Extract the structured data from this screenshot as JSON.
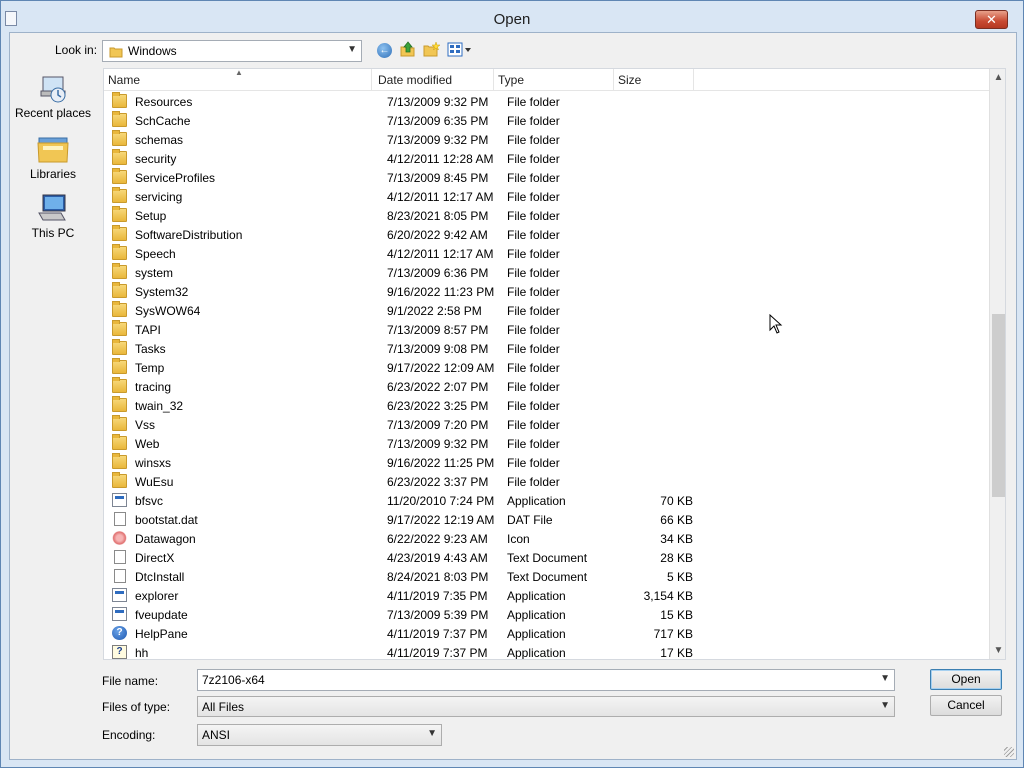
{
  "window": {
    "title": "Open",
    "close_label": "✕"
  },
  "toolbar": {
    "lookin_label": "Look in:",
    "lookin_value": "Windows",
    "icons": [
      "back-icon",
      "up-folder-icon",
      "new-folder-icon",
      "views-menu-icon"
    ]
  },
  "places": [
    {
      "label": "Recent places",
      "icon": "recent-places-icon"
    },
    {
      "label": "Libraries",
      "icon": "libraries-icon"
    },
    {
      "label": "This PC",
      "icon": "this-pc-icon"
    }
  ],
  "columns": {
    "name": "Name",
    "date": "Date modified",
    "type": "Type",
    "size": "Size"
  },
  "files": [
    {
      "name": "Resources",
      "date": "7/13/2009 9:32 PM",
      "type": "File folder",
      "size": "",
      "icon": "folder"
    },
    {
      "name": "SchCache",
      "date": "7/13/2009 6:35 PM",
      "type": "File folder",
      "size": "",
      "icon": "folder"
    },
    {
      "name": "schemas",
      "date": "7/13/2009 9:32 PM",
      "type": "File folder",
      "size": "",
      "icon": "folder"
    },
    {
      "name": "security",
      "date": "4/12/2011 12:28 AM",
      "type": "File folder",
      "size": "",
      "icon": "folder"
    },
    {
      "name": "ServiceProfiles",
      "date": "7/13/2009 8:45 PM",
      "type": "File folder",
      "size": "",
      "icon": "folder"
    },
    {
      "name": "servicing",
      "date": "4/12/2011 12:17 AM",
      "type": "File folder",
      "size": "",
      "icon": "folder"
    },
    {
      "name": "Setup",
      "date": "8/23/2021 8:05 PM",
      "type": "File folder",
      "size": "",
      "icon": "folder"
    },
    {
      "name": "SoftwareDistribution",
      "date": "6/20/2022 9:42 AM",
      "type": "File folder",
      "size": "",
      "icon": "folder"
    },
    {
      "name": "Speech",
      "date": "4/12/2011 12:17 AM",
      "type": "File folder",
      "size": "",
      "icon": "folder"
    },
    {
      "name": "system",
      "date": "7/13/2009 6:36 PM",
      "type": "File folder",
      "size": "",
      "icon": "folder"
    },
    {
      "name": "System32",
      "date": "9/16/2022 11:23 PM",
      "type": "File folder",
      "size": "",
      "icon": "folder"
    },
    {
      "name": "SysWOW64",
      "date": "9/1/2022 2:58 PM",
      "type": "File folder",
      "size": "",
      "icon": "folder"
    },
    {
      "name": "TAPI",
      "date": "7/13/2009 8:57 PM",
      "type": "File folder",
      "size": "",
      "icon": "folder"
    },
    {
      "name": "Tasks",
      "date": "7/13/2009 9:08 PM",
      "type": "File folder",
      "size": "",
      "icon": "folder"
    },
    {
      "name": "Temp",
      "date": "9/17/2022 12:09 AM",
      "type": "File folder",
      "size": "",
      "icon": "folder"
    },
    {
      "name": "tracing",
      "date": "6/23/2022 2:07 PM",
      "type": "File folder",
      "size": "",
      "icon": "folder"
    },
    {
      "name": "twain_32",
      "date": "6/23/2022 3:25 PM",
      "type": "File folder",
      "size": "",
      "icon": "folder"
    },
    {
      "name": "Vss",
      "date": "7/13/2009 7:20 PM",
      "type": "File folder",
      "size": "",
      "icon": "folder"
    },
    {
      "name": "Web",
      "date": "7/13/2009 9:32 PM",
      "type": "File folder",
      "size": "",
      "icon": "folder"
    },
    {
      "name": "winsxs",
      "date": "9/16/2022 11:25 PM",
      "type": "File folder",
      "size": "",
      "icon": "folder"
    },
    {
      "name": "WuEsu",
      "date": "6/23/2022 3:37 PM",
      "type": "File folder",
      "size": "",
      "icon": "folder"
    },
    {
      "name": "bfsvc",
      "date": "11/20/2010 7:24 PM",
      "type": "Application",
      "size": "70 KB",
      "icon": "app"
    },
    {
      "name": "bootstat.dat",
      "date": "9/17/2022 12:19 AM",
      "type": "DAT File",
      "size": "66 KB",
      "icon": "file"
    },
    {
      "name": "Datawagon",
      "date": "6/22/2022 9:23 AM",
      "type": "Icon",
      "size": "34 KB",
      "icon": "icon"
    },
    {
      "name": "DirectX",
      "date": "4/23/2019 4:43 AM",
      "type": "Text Document",
      "size": "28 KB",
      "icon": "file"
    },
    {
      "name": "DtcInstall",
      "date": "8/24/2021 8:03 PM",
      "type": "Text Document",
      "size": "5 KB",
      "icon": "file"
    },
    {
      "name": "explorer",
      "date": "4/11/2019 7:35 PM",
      "type": "Application",
      "size": "3,154 KB",
      "icon": "app"
    },
    {
      "name": "fveupdate",
      "date": "7/13/2009 5:39 PM",
      "type": "Application",
      "size": "15 KB",
      "icon": "app"
    },
    {
      "name": "HelpPane",
      "date": "4/11/2019 7:37 PM",
      "type": "Application",
      "size": "717 KB",
      "icon": "help"
    },
    {
      "name": "hh",
      "date": "4/11/2019 7:37 PM",
      "type": "Application",
      "size": "17 KB",
      "icon": "hh"
    }
  ],
  "fields": {
    "filename_label": "File name:",
    "filename_value": "7z2106-x64",
    "filetype_label": "Files of type:",
    "filetype_value": "All Files",
    "encoding_label": "Encoding:",
    "encoding_value": "ANSI"
  },
  "buttons": {
    "open": "Open",
    "cancel": "Cancel"
  },
  "scroll_position": 0.53
}
